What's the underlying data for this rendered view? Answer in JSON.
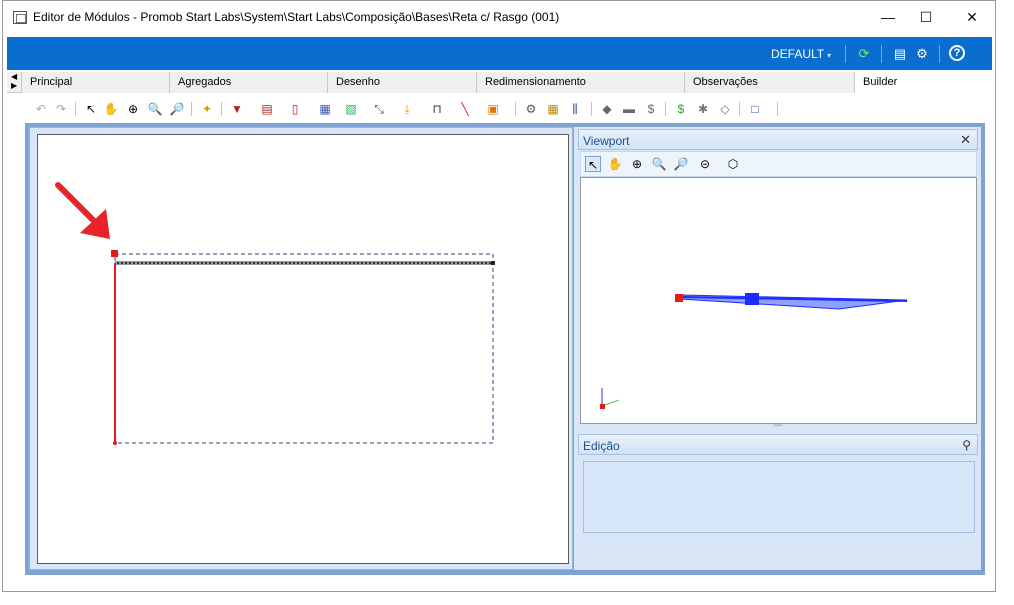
{
  "window": {
    "title": "Editor de Módulos - Promob Start Labs\\System\\Start Labs\\Composição\\Bases\\Reta c/ Rasgo (001)",
    "minimize": "—",
    "maximize": "☐",
    "close": "✕"
  },
  "header": {
    "profile_label": "DEFAULT",
    "profile_caret": "▾",
    "refresh_icon": "⟳",
    "list_icon": "▤",
    "settings_icon": "⚙",
    "help_icon": "?"
  },
  "tabs": [
    {
      "label": "Principal"
    },
    {
      "label": "Agregados"
    },
    {
      "label": "Desenho"
    },
    {
      "label": "Redimensionamento"
    },
    {
      "label": "Observações"
    },
    {
      "label": "Builder"
    }
  ],
  "tab_arrows": {
    "left": "◀",
    "right": "▶"
  },
  "toolbar": {
    "undo": "↶",
    "redo": "↷",
    "select": "↖",
    "pan": "✋",
    "zoom_plus": "⊕",
    "zoom_window": "🔍",
    "zoom_extents": "🔎",
    "new": "✦",
    "tool1": "▼",
    "tool2": "▤",
    "tool3": "▯",
    "tool4": "▦",
    "tool5": "▧",
    "tool6": "⤡",
    "tool7": "⤓",
    "tool8": "⊓",
    "tool9": "╲",
    "tool10": "▣",
    "tool11": "⚙",
    "tool12": "▦",
    "tool13": "⫼",
    "tool14": "◆",
    "tool15": "▬",
    "tool16": "$",
    "tool17": "$",
    "tool18": "✱",
    "tool19": "◇",
    "tool20": "□"
  },
  "viewport": {
    "title": "Viewport",
    "close": "✕",
    "tools": [
      "↖",
      "✋",
      "⊕",
      "🔍",
      "🔎",
      "⊝",
      "⬡"
    ]
  },
  "edicao": {
    "title": "Edição",
    "pin": "⚲"
  },
  "colors": {
    "accent": "#0a6ed1",
    "panel_bg": "#d8e6f7",
    "selection_red": "#e41b1b",
    "arrow_red": "#e8232a",
    "viewport_blue": "#1c2cff"
  }
}
